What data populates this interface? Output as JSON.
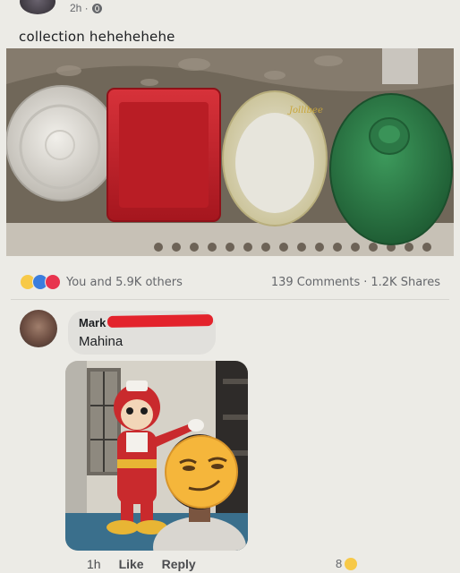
{
  "post": {
    "time": "2h ·",
    "caption": "collection hehehehehe"
  },
  "reactions": {
    "icons": [
      "haha-icon",
      "like-icon",
      "love-icon"
    ],
    "summary": "You and 5.9K others",
    "comments": "139 Comments",
    "separator": "·",
    "shares": "1.2K Shares"
  },
  "comment": {
    "author": "Mark",
    "text": "Mahina",
    "time": "1h",
    "like_label": "Like",
    "reply_label": "Reply",
    "reaction_count": "8",
    "reaction_icon": "haha-icon"
  },
  "photo_text": {
    "brand": "Jollibee"
  },
  "colors": {
    "bowl": "#d9d6cf",
    "red_tray": "#c8202a",
    "cream_plate": "#ddd7b7",
    "green_plate": "#2f7d4a",
    "redaction": "#e3232c",
    "haha": "#f7c948",
    "like": "#3b7ddd",
    "love": "#e8344e"
  }
}
